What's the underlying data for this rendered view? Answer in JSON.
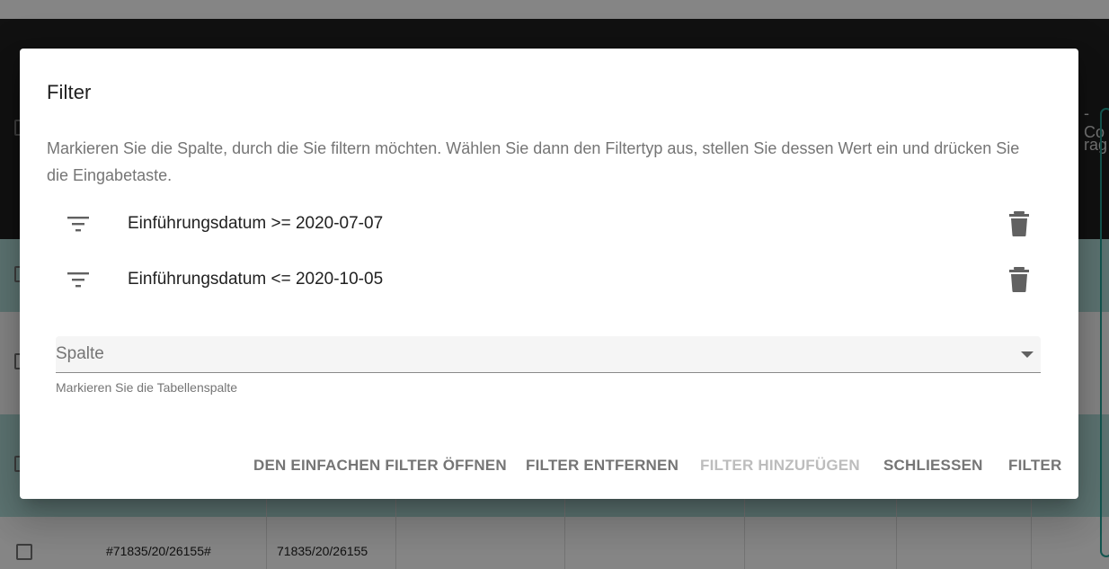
{
  "background": {
    "header_partial_text_1": "-Co",
    "header_partial_text_2": "rag",
    "rows": [
      {
        "col1": "#71835/20/26155#",
        "col2": "71835/20/26155"
      }
    ]
  },
  "dialog": {
    "title": "Filter",
    "description": "Markieren Sie die Spalte, durch die Sie filtern möchten. Wählen Sie dann den Filtertyp aus, stellen Sie dessen Wert ein und drücken Sie die Eingabetaste.",
    "filters": [
      {
        "text": "Einführungsdatum >= 2020-07-07",
        "icon": "filter-list-icon",
        "delete_icon": "trash-icon"
      },
      {
        "text": "Einführungsdatum <= 2020-10-05",
        "icon": "filter-list-icon",
        "delete_icon": "trash-icon"
      }
    ],
    "column_select": {
      "label": "Spalte",
      "helper": "Markieren Sie die Tabellenspalte"
    },
    "actions": {
      "open_simple_filter": "DEN EINFACHEN FILTER ÖFFNEN",
      "remove_filter": "FILTER ENTFERNEN",
      "add_filter": "FILTER HINZUFÜGEN",
      "close": "SCHLIESSEN",
      "filter": "FILTER"
    }
  },
  "colors": {
    "header_dark": "#212121",
    "row_highlight": "#b2dfdb",
    "accent": "#26a69a",
    "button_text": "#757575",
    "button_disabled": "#bdbdbd"
  }
}
